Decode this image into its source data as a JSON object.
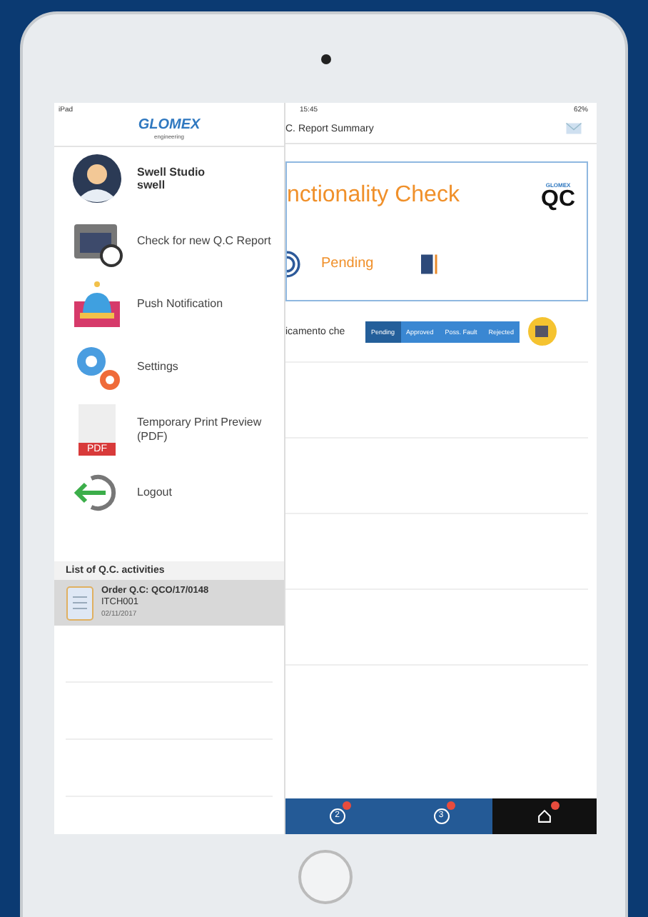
{
  "status_bar": {
    "carrier": "iPad",
    "time": "15:45",
    "battery": "62%"
  },
  "sidebar": {
    "logo": "GLOMEX",
    "logo_sub": "engineering",
    "profile": {
      "name": "Swell Studio",
      "user": "swell"
    },
    "menu": [
      {
        "kind": "folder",
        "label": "Check for new Q.C Report"
      },
      {
        "kind": "bell",
        "label": "Push Notification"
      },
      {
        "kind": "gears",
        "label": "Settings"
      },
      {
        "kind": "pdf",
        "label": "Temporary Print Preview (PDF)",
        "icon_text": "PDF"
      },
      {
        "kind": "logout",
        "label": "Logout"
      }
    ],
    "list_title": "List of Q.C. activities",
    "activities": [
      {
        "title": "Order Q.C: QCO/17/0148",
        "code": "ITCH001",
        "date": "02/11/2017",
        "selected": true
      }
    ]
  },
  "header": {
    "title": "C. Report Summary"
  },
  "card": {
    "title": "nctionality Check",
    "status": "Pending",
    "logo_top": "GLOMEX",
    "logo_main": "QC"
  },
  "check_row": {
    "label": "icamento che",
    "options": [
      {
        "label": "Pending",
        "selected": true
      },
      {
        "label": "Approved",
        "selected": false
      },
      {
        "label": "Poss. Fault",
        "selected": false
      },
      {
        "label": "Rejected",
        "selected": false
      }
    ]
  },
  "tabs": [
    {
      "kind": "number",
      "label": "2",
      "selected": false
    },
    {
      "kind": "number",
      "label": "3",
      "selected": false
    },
    {
      "kind": "home",
      "selected": true
    }
  ]
}
